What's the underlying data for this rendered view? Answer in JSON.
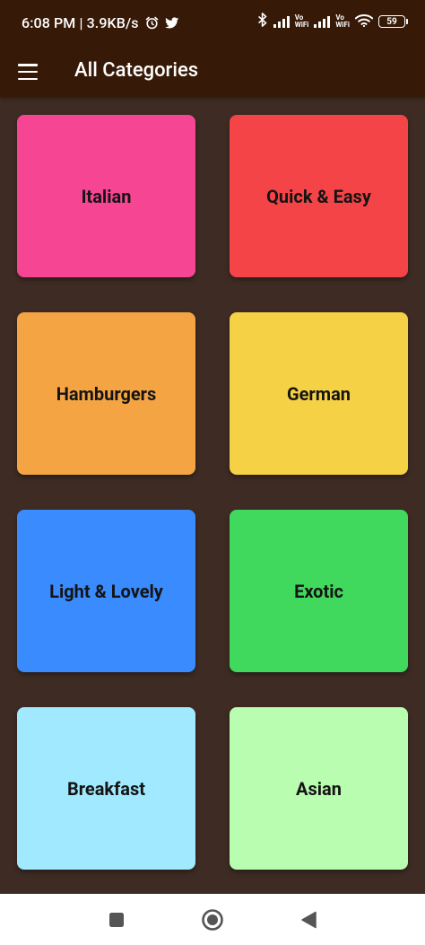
{
  "status_bar": {
    "time_speed": "6:08 PM | 3.9KB/s",
    "vowifi_top": "Vo",
    "vowifi_bottom": "WiFi",
    "battery": "59"
  },
  "app_bar": {
    "title": "All Categories"
  },
  "categories": [
    {
      "label": "Italian",
      "color": "#f54593"
    },
    {
      "label": "Quick & Easy",
      "color": "#f54447"
    },
    {
      "label": "Hamburgers",
      "color": "#f4a443"
    },
    {
      "label": "German",
      "color": "#f5d145"
    },
    {
      "label": "Light & Lovely",
      "color": "#3a8bfd"
    },
    {
      "label": "Exotic",
      "color": "#41d95d"
    },
    {
      "label": "Breakfast",
      "color": "#a1e9fe"
    },
    {
      "label": "Asian",
      "color": "#b9fdb0"
    }
  ],
  "colors": {
    "app_bar": "#361a07",
    "background": "#3e2c24",
    "nav_icons": "#555555"
  },
  "icons": {
    "menu": "hamburger-menu-icon",
    "alarm": "alarm-clock-icon",
    "twitter": "twitter-bird-icon",
    "bluetooth": "bluetooth-icon",
    "wifi": "wifi-icon",
    "recents": "square-recents-icon",
    "home": "circle-home-icon",
    "back": "triangle-back-icon"
  }
}
